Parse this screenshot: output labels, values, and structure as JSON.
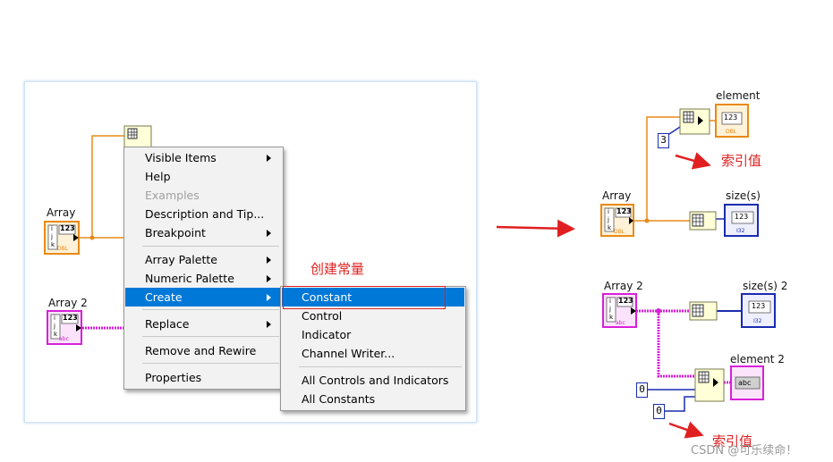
{
  "left": {
    "array_label": "Array",
    "array2_label": "Array 2",
    "node_text": "123",
    "dbl_tag": "DBL",
    "abc_tag": "abc",
    "idx_i": "i",
    "idx_j": "j",
    "idx_k": "k"
  },
  "context_menu": {
    "items": [
      {
        "label": "Visible Items"
      },
      {
        "label": "Help"
      },
      {
        "label": "Examples"
      },
      {
        "label": "Description and Tip..."
      },
      {
        "label": "Breakpoint"
      },
      {
        "label": "Array Palette"
      },
      {
        "label": "Numeric Palette"
      },
      {
        "label": "Create"
      },
      {
        "label": "Replace"
      },
      {
        "label": "Remove and Rewire"
      },
      {
        "label": "Properties"
      }
    ]
  },
  "create_submenu": {
    "items": [
      {
        "label": "Constant"
      },
      {
        "label": "Control"
      },
      {
        "label": "Indicator"
      },
      {
        "label": "Channel Writer..."
      },
      {
        "label": "All Controls and Indicators"
      },
      {
        "label": "All Constants"
      }
    ]
  },
  "annotations": {
    "create_constant": "创建常量",
    "index_value_1": "索引值",
    "index_value_2": "索引值"
  },
  "right": {
    "element_label": "element",
    "array_label": "Array",
    "sizes_label": "size(s)",
    "array2_label": "Array 2",
    "sizes2_label": "size(s) 2",
    "element2_label": "element 2",
    "const_3": "3",
    "const_0a": "0",
    "const_0b": "0",
    "node_text": "123",
    "dbl_tag": "DBL",
    "abc_tag": "abc",
    "i32_tag": "I32"
  },
  "watermark": "CSDN @可乐续命！",
  "colors": {
    "highlight": "#0078d7",
    "orange_wire": "#e88a17",
    "pink_wire": "#d820d8",
    "blue_wire": "#1a2cb0",
    "red_annotation": "#e02020"
  }
}
